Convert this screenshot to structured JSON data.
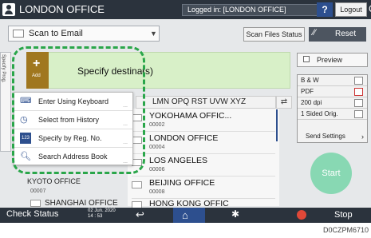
{
  "header": {
    "title": "LONDON OFFICE",
    "logged_in": "Logged in: [LONDON OFFICE]",
    "help_label": "?",
    "logout_label": "Logout",
    "corner_label": "C"
  },
  "toolbar": {
    "destination_type": "Scan to Email",
    "scan_files_status": "Scan Files Status",
    "reset_label": "Reset"
  },
  "specify": {
    "add_label": "Add",
    "text": "Specify destinat"
  },
  "left_strip": {
    "text": "Specify Prog."
  },
  "menu": {
    "items": [
      {
        "label": "Enter Using Keyboard",
        "icon": "keyboard-icon"
      },
      {
        "label": "Select from History",
        "icon": "history-icon"
      },
      {
        "label": "Specify by Reg. No.",
        "icon": "reg-number-icon"
      },
      {
        "label": "Search Address Book",
        "icon": "search-icon"
      }
    ]
  },
  "tabs": {
    "labels": "LMN  OPQ  RST  UVW  XYZ",
    "s_label": "(s)"
  },
  "addresses": [
    {
      "name": "YOKOHAMA OFFIC...",
      "number": "00002"
    },
    {
      "name": "LONDON OFFICE",
      "number": "00004"
    },
    {
      "name": "LOS ANGELES",
      "number": "00006"
    },
    {
      "name": "BEIJING OFFICE",
      "number": "00008"
    },
    {
      "name": "HONG KONG OFFIC",
      "number": ""
    }
  ],
  "left_addresses": [
    {
      "name": "KYOTO OFFICE",
      "number": "00007"
    },
    {
      "name": "SHANGHAI OFFICE",
      "number": ""
    }
  ],
  "side_panel": {
    "preview": "Preview",
    "settings": [
      "B & W",
      "PDF",
      "200 dpi",
      "1 Sided Orig."
    ],
    "send_settings": "Send Settings",
    "start": "Start"
  },
  "bottom_bar": {
    "check_status": "Check Status",
    "date": "02 Jun. 2020",
    "time": "14 : 53",
    "stop": "Stop"
  },
  "figure_code": "D0CZPM6710"
}
